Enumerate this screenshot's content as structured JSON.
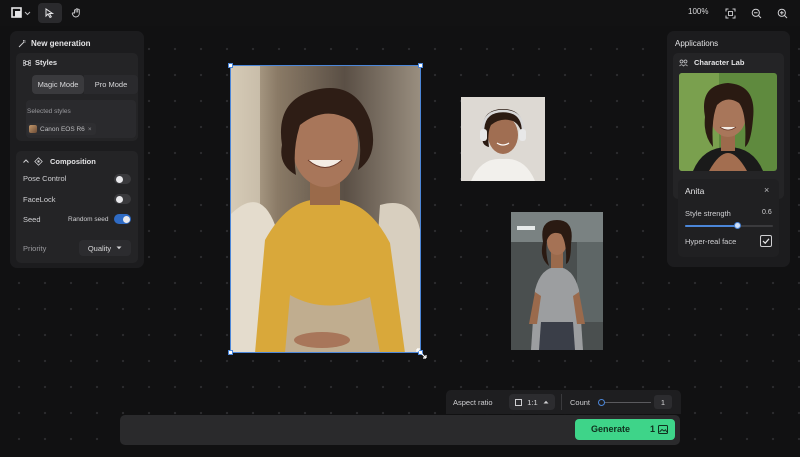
{
  "toolbar": {
    "tools": [
      {
        "icon": "logo-layers-icon"
      },
      {
        "icon": "select-cursor-icon"
      },
      {
        "icon": "hand-pan-icon"
      }
    ],
    "zoom": "100%",
    "right_icons": [
      "fit-screen-icon",
      "zoom-out-icon",
      "zoom-in-icon"
    ]
  },
  "left_panel": {
    "title": "New generation",
    "styles": {
      "title": "Styles",
      "modes": [
        "Magic Mode",
        "Pro Mode"
      ],
      "active_mode": "Magic Mode",
      "selected_label": "Selected styles",
      "chip": "Canon EOS R6"
    },
    "composition": {
      "title": "Composition",
      "pose_control": {
        "label": "Pose Control",
        "on": false
      },
      "facelock": {
        "label": "FaceLock",
        "on": false
      },
      "seed": {
        "label": "Seed",
        "hint": "Random seed",
        "on": true
      }
    },
    "priority": {
      "label": "Priority",
      "value": "Quality"
    }
  },
  "right_panel": {
    "title": "Applications",
    "app_name": "Character Lab",
    "character": "Anita",
    "style_strength": {
      "label": "Style strength",
      "value": "0.6",
      "fraction": 0.6
    },
    "hyper_real": {
      "label": "Hyper-real face",
      "checked": true
    }
  },
  "bottom": {
    "aspect_label": "Aspect ratio",
    "aspect_value": "1:1",
    "count_label": "Count",
    "count_value": "1",
    "generate_label": "Generate",
    "generate_count": "1"
  },
  "colors": {
    "accent_blue": "#4b86d8",
    "generate_green": "#3ed489",
    "panel_bg": "#1c1c1e"
  }
}
